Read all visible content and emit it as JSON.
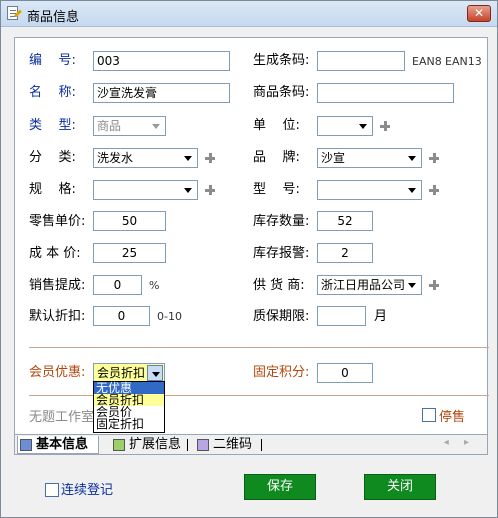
{
  "window": {
    "title": "商品信息",
    "close_label": "✕"
  },
  "left": {
    "code_label": "编    号:",
    "code_value": "003",
    "name_label": "名    称:",
    "name_value": "沙宣洗发膏",
    "type_label": "类    型:",
    "type_value": "商品",
    "category_label": "分    类:",
    "category_value": "洗发水",
    "spec_label": "规    格:",
    "spec_value": "",
    "retail_price_label": "零售单价:",
    "retail_price_value": "50",
    "cost_price_label": "成 本 价:",
    "cost_price_value": "25",
    "commission_label": "销售提成:",
    "commission_value": "0",
    "commission_unit": "%",
    "discount_label": "默认折扣:",
    "discount_value": "0",
    "discount_range": "0-10"
  },
  "right": {
    "gen_barcode_label": "生成条码:",
    "gen_barcode_value": "",
    "ean8_label": "EAN8",
    "ean13_label": "EAN13",
    "barcode_label": "商品条码:",
    "barcode_value": "",
    "unit_label": "单    位:",
    "unit_value": "",
    "brand_label": "品    牌:",
    "brand_value": "沙宣",
    "model_label": "型    号:",
    "model_value": "",
    "stock_qty_label": "库存数量:",
    "stock_qty_value": "52",
    "stock_alert_label": "库存报警:",
    "stock_alert_value": "2",
    "supplier_label": "供 货 商:",
    "supplier_value": "浙江日用品公司",
    "shelf_life_label": "质保期限:",
    "shelf_life_value": "",
    "shelf_life_unit": "月"
  },
  "member": {
    "discount_label": "会员优惠:",
    "discount_value": "会员折扣",
    "options": [
      "无优惠",
      "会员折扣",
      "会员价",
      "固定折扣"
    ],
    "points_label": "固定积分:",
    "points_value": "0"
  },
  "workstation": {
    "label": "无题工作室"
  },
  "stop_sale": {
    "label": "停售"
  },
  "tabs": [
    {
      "label": "基本信息"
    },
    {
      "label": "扩展信息"
    },
    {
      "label": "二维码"
    }
  ],
  "tab_arrows": "◂ ▸",
  "footer": {
    "continuous_label": "连续登记",
    "save_label": "保存",
    "close_label": "关闭"
  },
  "colors": {
    "label_blue": "#0b2f9e",
    "label_orange": "#b3460c",
    "button_green": "#0f8a1f",
    "tab_basic": "#6b8fd6",
    "tab_extended": "#9ad06a",
    "tab_qrcode": "#b9a4e6"
  }
}
